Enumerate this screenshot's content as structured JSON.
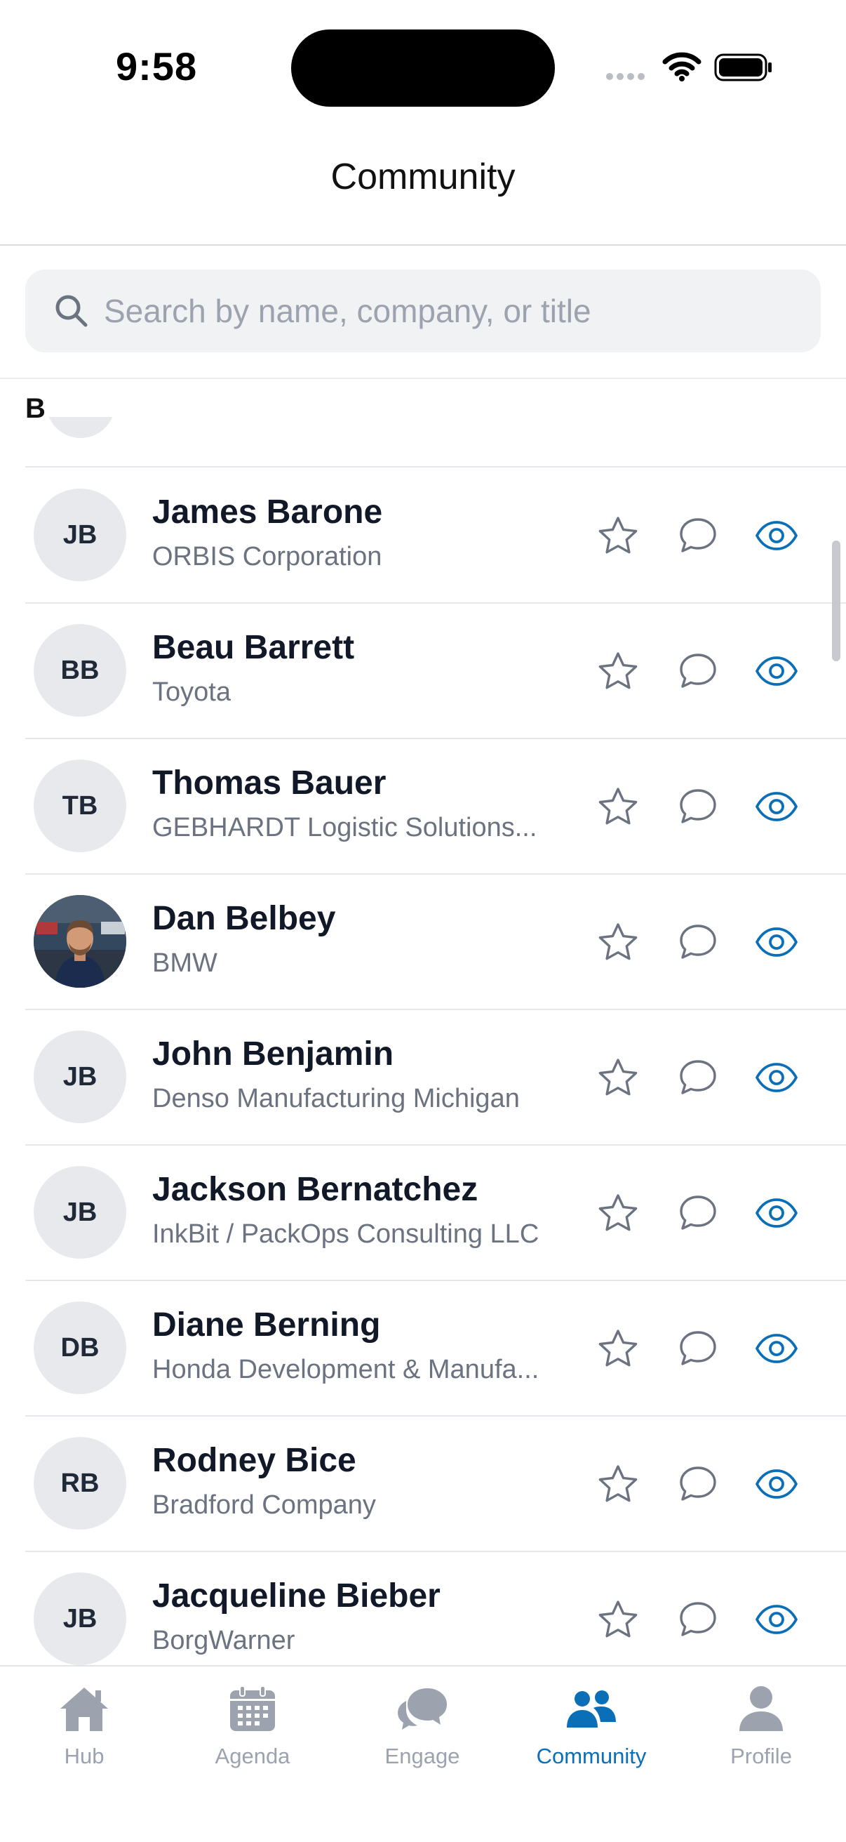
{
  "status_bar": {
    "time": "9:58"
  },
  "header": {
    "title": "Community"
  },
  "search": {
    "placeholder": "Search by name, company, or title"
  },
  "section": {
    "letter": "B"
  },
  "people": [
    {
      "initials": "JB",
      "name": "James Barone",
      "company": "ORBIS Corporation",
      "photo": false
    },
    {
      "initials": "BB",
      "name": "Beau Barrett",
      "company": "Toyota",
      "photo": false
    },
    {
      "initials": "TB",
      "name": "Thomas Bauer",
      "company": "GEBHARDT Logistic Solutions...",
      "photo": false
    },
    {
      "initials": "",
      "name": "Dan Belbey",
      "company": "BMW",
      "photo": true
    },
    {
      "initials": "JB",
      "name": "John Benjamin",
      "company": "Denso Manufacturing Michigan",
      "photo": false
    },
    {
      "initials": "JB",
      "name": "Jackson Bernatchez",
      "company": "InkBit / PackOps Consulting LLC",
      "photo": false
    },
    {
      "initials": "DB",
      "name": "Diane Berning",
      "company": "Honda Development & Manufa...",
      "photo": false
    },
    {
      "initials": "RB",
      "name": "Rodney Bice",
      "company": "Bradford Company",
      "photo": false
    },
    {
      "initials": "JB",
      "name": "Jacqueline Bieber",
      "company": "BorgWarner",
      "photo": false
    }
  ],
  "row_icons": [
    "star-icon",
    "chat-bubble-icon",
    "eye-icon"
  ],
  "tabs": [
    {
      "label": "Hub",
      "icon": "home-icon",
      "active": false
    },
    {
      "label": "Agenda",
      "icon": "calendar-icon",
      "active": false
    },
    {
      "label": "Engage",
      "icon": "chat-bubbles-icon",
      "active": false
    },
    {
      "label": "Community",
      "icon": "people-icon",
      "active": true
    },
    {
      "label": "Profile",
      "icon": "person-icon",
      "active": false
    }
  ],
  "colors": {
    "accent": "#0b6fb8",
    "inactive_icon": "#6b7280",
    "tab_inactive": "#9ca3af",
    "avatar_bg": "#e8e9ec"
  }
}
